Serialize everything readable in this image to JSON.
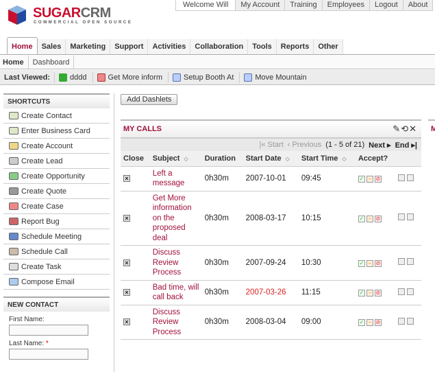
{
  "brand": {
    "name_red": "SUGAR",
    "name_gray": "CRM",
    "tagline": "COMMERCIAL OPEN SOURCE"
  },
  "top_links": [
    "Welcome Will",
    "My Account",
    "Training",
    "Employees",
    "Logout",
    "About"
  ],
  "tabs": [
    "Home",
    "Sales",
    "Marketing",
    "Support",
    "Activities",
    "Collaboration",
    "Tools",
    "Reports",
    "Other"
  ],
  "active_tab": "Home",
  "subnav": [
    "Home",
    "Dashboard"
  ],
  "last_viewed": {
    "label": "Last Viewed:",
    "items": [
      "dddd",
      "Get More inform",
      "Setup Booth At",
      "Move Mountain"
    ]
  },
  "shortcuts": {
    "title": "SHORTCUTS",
    "items": [
      "Create Contact",
      "Enter Business Card",
      "Create Account",
      "Create Lead",
      "Create Opportunity",
      "Create Quote",
      "Create Case",
      "Report Bug",
      "Schedule Meeting",
      "Schedule Call",
      "Create Task",
      "Compose Email"
    ]
  },
  "new_contact": {
    "title": "NEW CONTACT",
    "first_name_label": "First Name:",
    "last_name_label": "Last Name:",
    "required_mark": "*",
    "first_name": "",
    "last_name": ""
  },
  "add_dashlets": "Add Dashlets",
  "my_calls": {
    "title": "MY CALLS",
    "pager": {
      "start": "Start",
      "previous": "Previous",
      "range": "(1 - 5 of 21)",
      "next": "Next",
      "end": "End"
    },
    "columns": [
      "Close",
      "Subject",
      "Duration",
      "Start Date",
      "Start Time",
      "Accept?"
    ],
    "rows": [
      {
        "subject": "Left a message",
        "duration": "0h30m",
        "start_date": "2007-10-01",
        "start_time": "09:45",
        "overdue": false
      },
      {
        "subject": "Get More information on the proposed deal",
        "duration": "0h30m",
        "start_date": "2008-03-17",
        "start_time": "10:15",
        "overdue": false
      },
      {
        "subject": "Discuss Review Process",
        "duration": "0h30m",
        "start_date": "2007-09-24",
        "start_time": "10:30",
        "overdue": false
      },
      {
        "subject": "Bad time, will call back",
        "duration": "0h30m",
        "start_date": "2007-03-26",
        "start_time": "11:15",
        "overdue": true
      },
      {
        "subject": "Discuss Review Process",
        "duration": "0h30m",
        "start_date": "2008-03-04",
        "start_time": "09:00",
        "overdue": false
      }
    ]
  },
  "second_dashlet_title": "M",
  "colors": {
    "accent": "#a0103a",
    "overdue": "#dd2222"
  }
}
